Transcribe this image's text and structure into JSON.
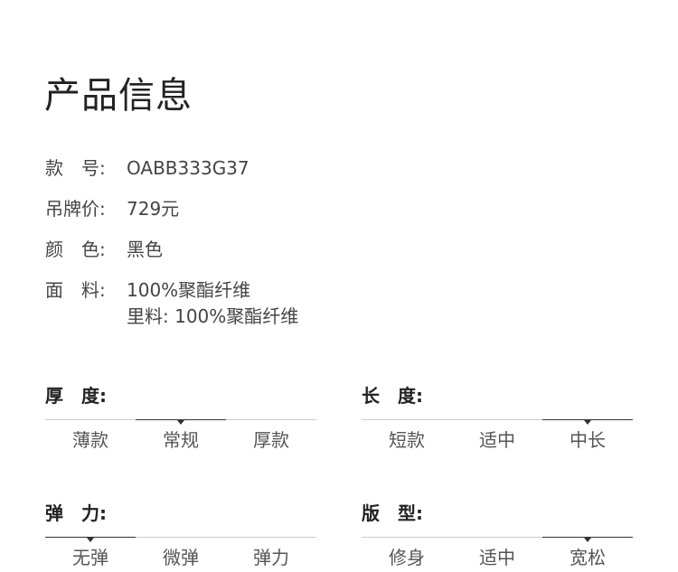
{
  "title": "产品信息",
  "info": {
    "style_no": {
      "label": "款　号:",
      "value": "OABB333G37"
    },
    "price": {
      "label": "吊牌价:",
      "value": "729元"
    },
    "color": {
      "label": "颜　色:",
      "value": "黑色"
    },
    "fabric": {
      "label": "面　料:",
      "value": "100%聚酯纤维",
      "lining": "里料:  100%聚酯纤维"
    }
  },
  "attributes": {
    "thickness": {
      "title": "厚　度:",
      "options": [
        "薄款",
        "常规",
        "厚款"
      ],
      "selected_index": 1
    },
    "length": {
      "title": "长　度:",
      "options": [
        "短款",
        "适中",
        "中长"
      ],
      "selected_index": 2
    },
    "elasticity": {
      "title": "弹　力:",
      "options": [
        "无弹",
        "微弹",
        "弹力"
      ],
      "selected_index": 0
    },
    "fit": {
      "title": "版　型:",
      "options": [
        "修身",
        "适中",
        "宽松"
      ],
      "selected_index": 2
    }
  }
}
